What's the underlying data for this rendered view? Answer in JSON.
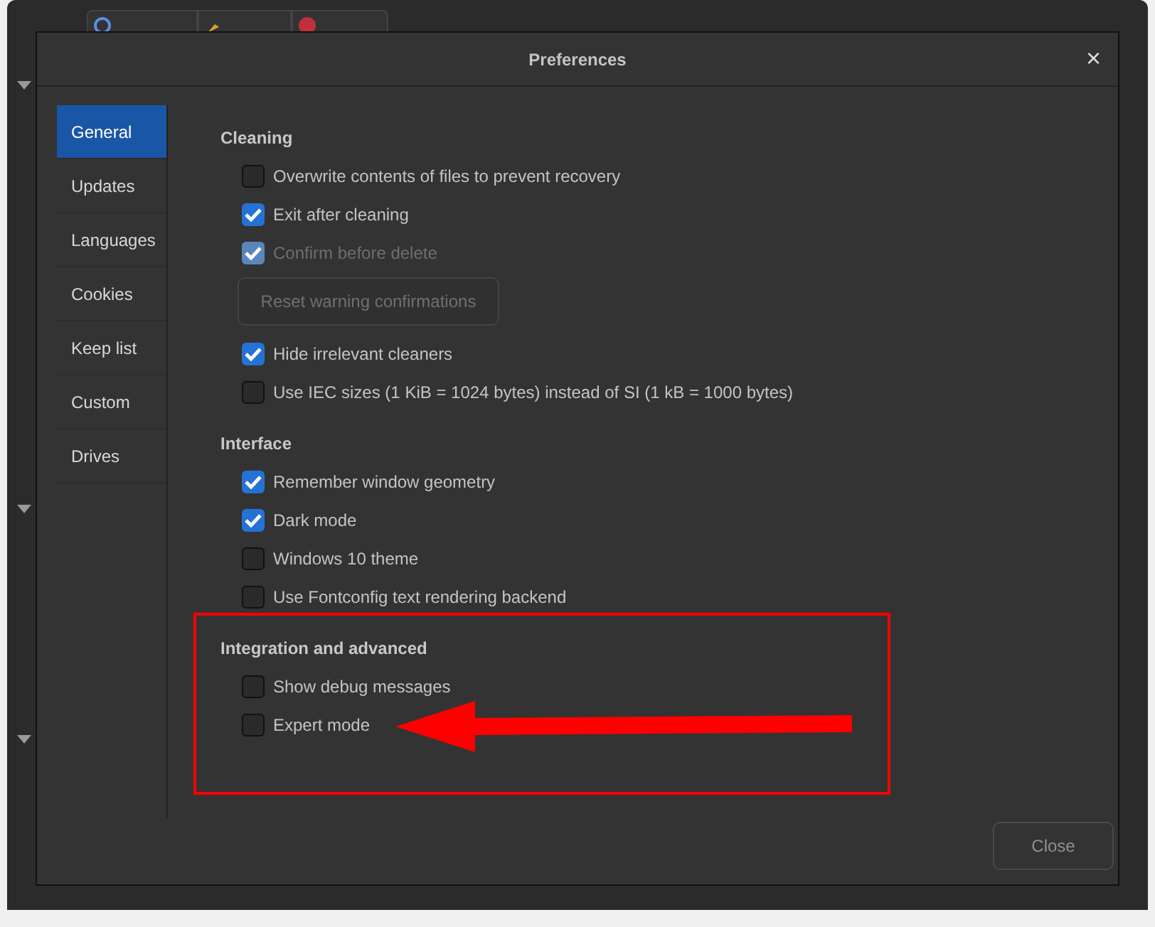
{
  "dialog": {
    "title": "Preferences",
    "close_glyph": "×"
  },
  "sidebar": {
    "items": [
      {
        "label": "General",
        "selected": true
      },
      {
        "label": "Updates",
        "selected": false
      },
      {
        "label": "Languages",
        "selected": false
      },
      {
        "label": "Cookies",
        "selected": false
      },
      {
        "label": "Keep list",
        "selected": false
      },
      {
        "label": "Custom",
        "selected": false
      },
      {
        "label": "Drives",
        "selected": false
      }
    ]
  },
  "sections": [
    {
      "heading": "Cleaning",
      "options": [
        {
          "kind": "checkbox",
          "label": "Overwrite contents of files to prevent recovery",
          "checked": false,
          "disabled": false
        },
        {
          "kind": "checkbox",
          "label": "Exit after cleaning",
          "checked": true,
          "disabled": false
        },
        {
          "kind": "checkbox",
          "label": "Confirm before delete",
          "checked": true,
          "disabled": true
        },
        {
          "kind": "button",
          "label": "Reset warning confirmations",
          "disabled": true
        },
        {
          "kind": "checkbox",
          "label": "Hide irrelevant cleaners",
          "checked": true,
          "disabled": false
        },
        {
          "kind": "checkbox",
          "label": "Use IEC sizes (1 KiB = 1024 bytes) instead of SI (1 kB = 1000 bytes)",
          "checked": false,
          "disabled": false
        }
      ]
    },
    {
      "heading": "Interface",
      "options": [
        {
          "kind": "checkbox",
          "label": "Remember window geometry",
          "checked": true,
          "disabled": false
        },
        {
          "kind": "checkbox",
          "label": "Dark mode",
          "checked": true,
          "disabled": false
        },
        {
          "kind": "checkbox",
          "label": "Windows 10 theme",
          "checked": false,
          "disabled": false
        },
        {
          "kind": "checkbox",
          "label": "Use Fontconfig text rendering backend",
          "checked": false,
          "disabled": false
        }
      ]
    },
    {
      "heading": "Integration and advanced",
      "options": [
        {
          "kind": "checkbox",
          "label": "Show debug messages",
          "checked": false,
          "disabled": false
        },
        {
          "kind": "checkbox",
          "label": "Expert mode",
          "checked": false,
          "disabled": false
        }
      ]
    }
  ],
  "footer": {
    "button": "Close"
  }
}
